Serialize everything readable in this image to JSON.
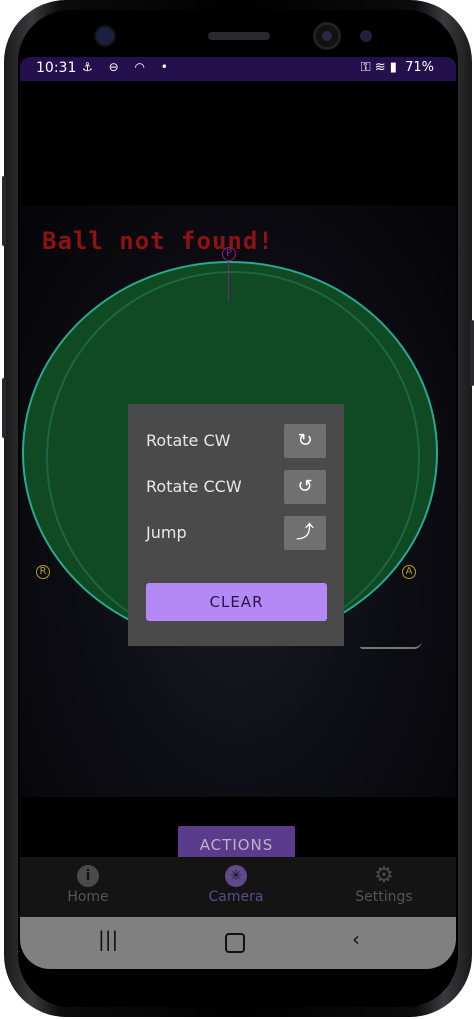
{
  "statusbar": {
    "time": "10:31",
    "left_icons": "⚓ ⊖ ◠ •",
    "right_icons": "⚿ ≋ ▮",
    "battery": "71%"
  },
  "camera": {
    "status_message": "Ball not found!",
    "marker_top": "P",
    "marker_left": "R",
    "marker_right": "A"
  },
  "actions_popup": {
    "items": [
      {
        "label": "Rotate CW",
        "icon": "rotate-cw-icon",
        "glyph": "↻"
      },
      {
        "label": "Rotate CCW",
        "icon": "rotate-ccw-icon",
        "glyph": "↺"
      },
      {
        "label": "Jump",
        "icon": "jump-icon",
        "glyph": "⤴"
      }
    ],
    "clear_label": "CLEAR"
  },
  "actions_button": {
    "label": "ACTIONS"
  },
  "bottom_nav": {
    "items": [
      {
        "label": "Home",
        "icon": "info-icon",
        "glyph": "i"
      },
      {
        "label": "Camera",
        "icon": "camera-aperture-icon",
        "glyph": "✳"
      },
      {
        "label": "Settings",
        "icon": "gear-icon",
        "glyph": "⚙"
      }
    ]
  },
  "system_nav": {
    "recents": "|||",
    "home": "",
    "back": "‹"
  },
  "colors": {
    "accent": "#b489f5",
    "status_bar": "#24104d",
    "error_text": "#8e1212"
  }
}
